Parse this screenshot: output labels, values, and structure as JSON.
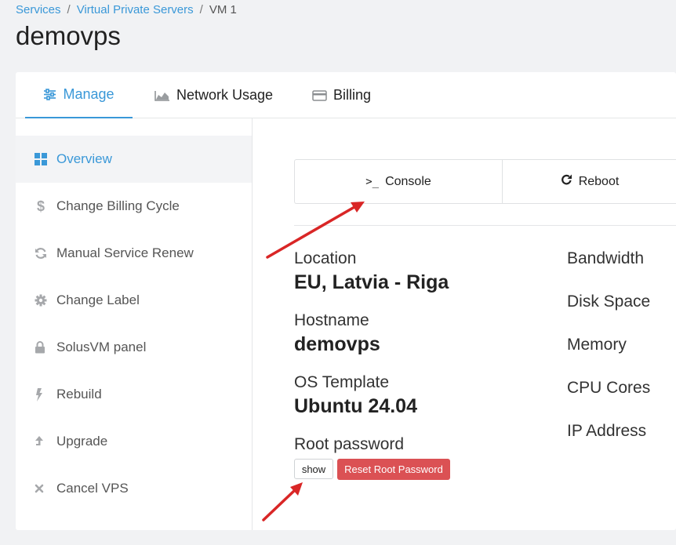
{
  "breadcrumb": {
    "items": [
      "Services",
      "Virtual Private Servers"
    ],
    "current": "VM 1",
    "separator": "/"
  },
  "page": {
    "title": "demovps"
  },
  "tabs": [
    {
      "label": "Manage",
      "icon": "sliders-icon",
      "active": true
    },
    {
      "label": "Network Usage",
      "icon": "area-chart-icon"
    },
    {
      "label": "Billing",
      "icon": "credit-card-icon"
    }
  ],
  "sidebar": {
    "items": [
      {
        "label": "Overview",
        "icon": "grid-icon",
        "active": true
      },
      {
        "label": "Change Billing Cycle",
        "icon": "dollar-icon"
      },
      {
        "label": "Manual Service Renew",
        "icon": "refresh-icon"
      },
      {
        "label": "Change Label",
        "icon": "gear-icon"
      },
      {
        "label": "SolusVM panel",
        "icon": "lock-icon"
      },
      {
        "label": "Rebuild",
        "icon": "bolt-icon"
      },
      {
        "label": "Upgrade",
        "icon": "arrow-up-icon"
      },
      {
        "label": "Cancel VPS",
        "icon": "close-icon"
      }
    ]
  },
  "actions": {
    "console": {
      "label": "Console",
      "icon": ">_"
    },
    "reboot": {
      "label": "Reboot",
      "icon": "reboot-icon"
    }
  },
  "details": {
    "location": {
      "label": "Location",
      "value": "EU, Latvia - Riga"
    },
    "hostname": {
      "label": "Hostname",
      "value": "demovps"
    },
    "os_template": {
      "label": "OS Template",
      "value": "Ubuntu 24.04"
    },
    "root_password": {
      "label": "Root password",
      "show_label": "show",
      "reset_label": "Reset Root Password"
    }
  },
  "resources": [
    "Bandwidth",
    "Disk Space",
    "Memory",
    "CPU Cores",
    "IP Address"
  ],
  "colors": {
    "accent": "#3a98d8",
    "danger": "#db5154",
    "annotation_arrow": "#d92626"
  }
}
